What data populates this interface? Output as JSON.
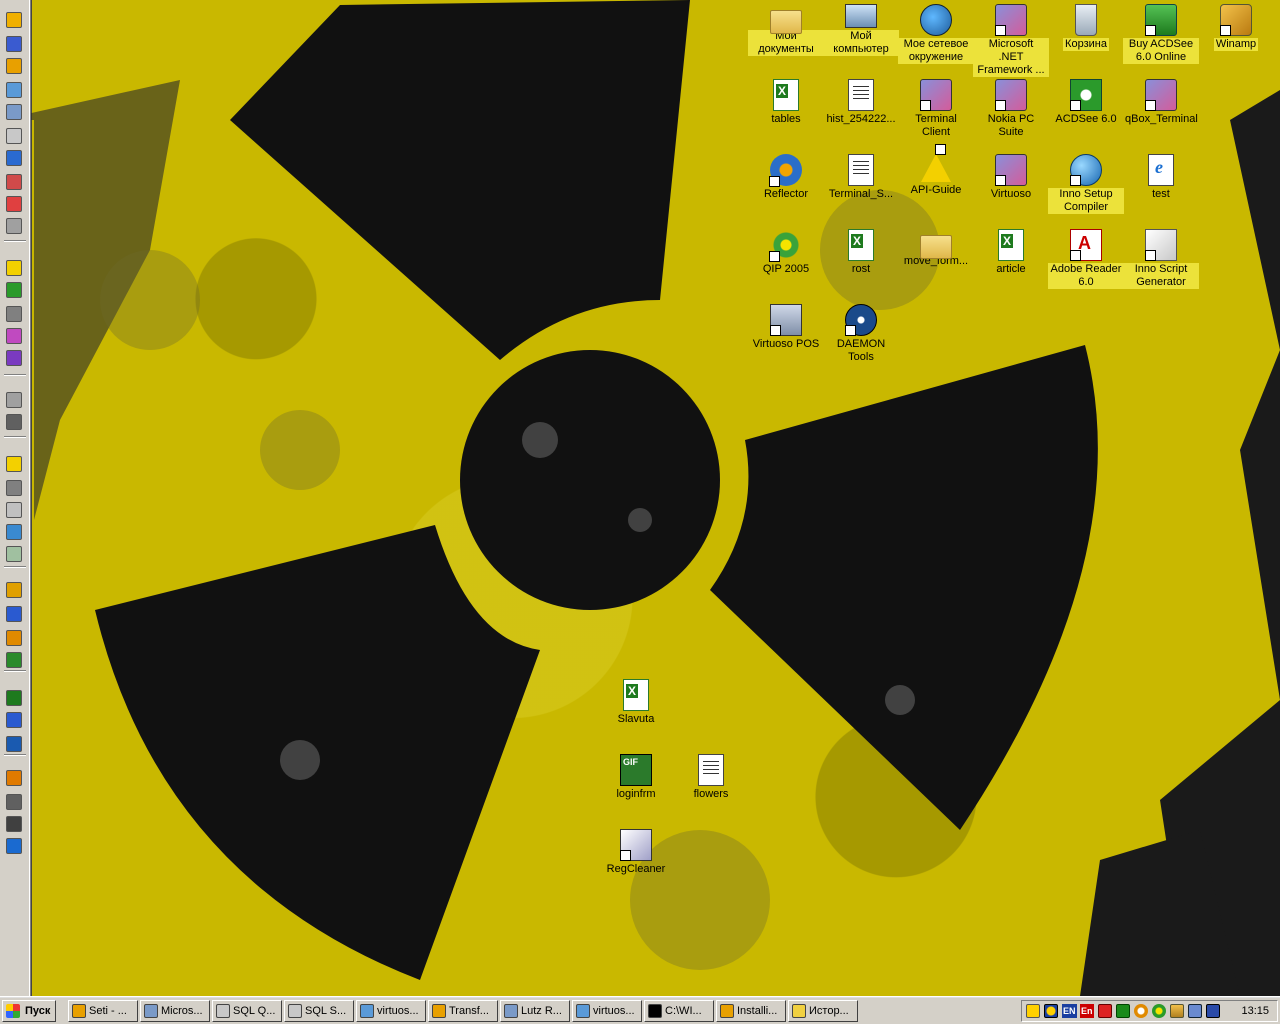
{
  "desktop_icons": [
    {
      "label": "Мои документы",
      "type": "folder"
    },
    {
      "label": "Мой компьютер",
      "type": "pc"
    },
    {
      "label": "Мое сетевое окружение",
      "type": "net"
    },
    {
      "label": "Microsoft .NET Framework ...",
      "type": "app"
    },
    {
      "label": "Корзина",
      "type": "bin"
    },
    {
      "label": "Buy ACDSee 6.0 Online",
      "type": "cart"
    },
    {
      "label": "Winamp",
      "type": "winamp"
    },
    {
      "label": "tables",
      "type": "xls"
    },
    {
      "label": "hist_254222...",
      "type": "doc"
    },
    {
      "label": "Terminal Client",
      "type": "app"
    },
    {
      "label": "Nokia PC Suite",
      "type": "app"
    },
    {
      "label": "ACDSee 6.0",
      "type": "eye"
    },
    {
      "label": "qBox_Terminal",
      "type": "app"
    },
    {
      "label": "Reflector",
      "type": "gear"
    },
    {
      "label": "Terminal_S...",
      "type": "doc"
    },
    {
      "label": "API-Guide",
      "type": "warn"
    },
    {
      "label": "Virtuoso",
      "type": "app"
    },
    {
      "label": "Inno Setup Compiler",
      "type": "globe"
    },
    {
      "label": "test",
      "type": "ie"
    },
    {
      "label": "QIP 2005",
      "type": "flower"
    },
    {
      "label": "rost",
      "type": "xls"
    },
    {
      "label": "move_form...",
      "type": "folder"
    },
    {
      "label": "article",
      "type": "xls"
    },
    {
      "label": "Adobe Reader 6.0",
      "type": "pdf"
    },
    {
      "label": "Inno Script Generator",
      "type": "script"
    },
    {
      "label": "Virtuoso POS",
      "type": "pos"
    },
    {
      "label": "DAEMON Tools",
      "type": "daemon"
    },
    {
      "label": "Slavuta",
      "type": "xls"
    },
    {
      "label": "loginfrm",
      "type": "gif"
    },
    {
      "label": "flowers",
      "type": "doc"
    },
    {
      "label": "RegCleaner",
      "type": "reg"
    }
  ],
  "taskbar": {
    "start_label": "Пуск",
    "buttons": [
      "Seti - ...",
      "Micros...",
      "SQL Q...",
      "SQL S...",
      "virtuos...",
      "Transf...",
      "Lutz R...",
      "virtuos...",
      "C:\\WI...",
      "Installi...",
      "Истор..."
    ],
    "tray": {
      "lang1": "EN",
      "lang2": "En",
      "clock": "13:15"
    }
  },
  "colors": {
    "wallpaper_yellow": "#c9b800",
    "symbol_black": "#111111",
    "label_highlight": "#ece23a",
    "taskbar_gray": "#d4d0c8"
  }
}
